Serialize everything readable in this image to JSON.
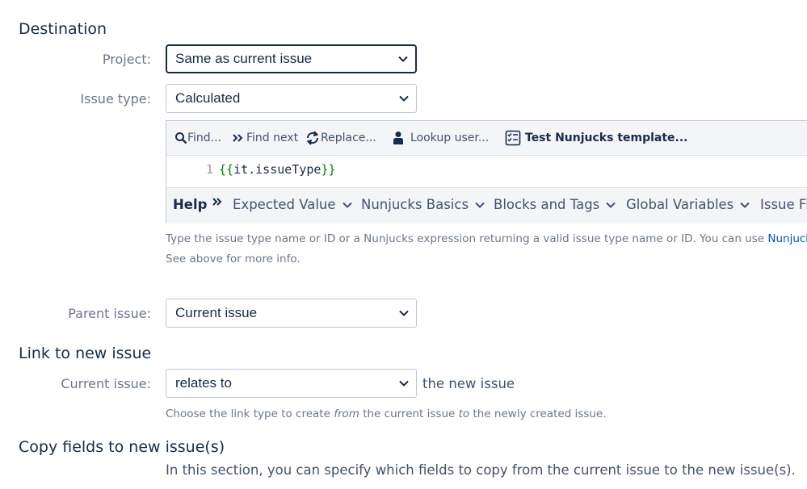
{
  "destination": {
    "title": "Destination",
    "project": {
      "label": "Project:",
      "value": "Same as current issue"
    },
    "issue_type": {
      "label": "Issue type:",
      "value": "Calculated"
    },
    "editor": {
      "toolbar": {
        "find": "Find...",
        "find_next": "Find next",
        "replace": "Replace...",
        "lookup_user": "Lookup user...",
        "test_template": "Test Nunjucks template..."
      },
      "line_number": "1",
      "code_open": "{{",
      "code_body": "it.issueType",
      "code_close": "}}",
      "help": {
        "label": "Help",
        "items": [
          "Expected Value",
          "Nunjucks Basics",
          "Blocks and Tags",
          "Global Variables",
          "Issue Fie"
        ]
      }
    },
    "issue_type_desc_prefix": "Type the issue type name or ID or a Nunjucks expression returning a valid issue type name or ID. You can use ",
    "issue_type_desc_link": "Nunjucks a",
    "issue_type_desc_line2": "See above for more info.",
    "parent_issue": {
      "label": "Parent issue:",
      "value": "Current issue"
    }
  },
  "link": {
    "title": "Link to new issue",
    "current_issue": {
      "label": "Current issue:",
      "value": "relates to",
      "suffix": "the new issue"
    },
    "desc_part1": "Choose the link type to create ",
    "desc_em1": "from",
    "desc_part2": " the current issue ",
    "desc_em2": "to",
    "desc_part3": " the newly created issue."
  },
  "copy": {
    "title": "Copy fields to new issue(s)",
    "desc": "In this section, you can specify which fields to copy from the current issue to the new issue(s)."
  },
  "colors": {
    "text": "#172b4d",
    "label": "#6b778c",
    "link": "#0052cc",
    "code_brace": "#008000",
    "toolbar_bg": "#f4f5f7"
  }
}
